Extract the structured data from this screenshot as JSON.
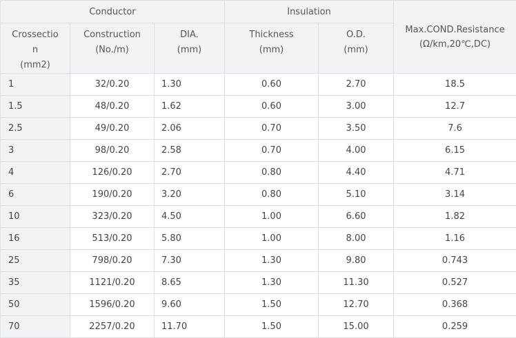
{
  "header": {
    "conductor": "Conductor",
    "insulation": "Insulation",
    "max_resistance": [
      "Max.COND.Resistance",
      "(Ω/km,20℃,DC)"
    ],
    "columns": [
      [
        "Crossectio",
        "n",
        "(mm2)"
      ],
      [
        "Construction",
        "(No./m)"
      ],
      [
        "DIA.",
        "(mm)"
      ],
      [
        "Thickness",
        "(mm)"
      ],
      [
        "O.D.",
        "(mm)"
      ]
    ]
  },
  "rows": [
    [
      "1",
      "32/0.20",
      "1.30",
      "0.60",
      "2.70",
      "18.5"
    ],
    [
      "1.5",
      "48/0.20",
      "1.62",
      "0.60",
      "3.00",
      "12.7"
    ],
    [
      "2.5",
      "49/0.20",
      "2.06",
      "0.70",
      "3.50",
      "7.6"
    ],
    [
      "3",
      "98/0.20",
      "2.58",
      "0.70",
      "4.00",
      "6.15"
    ],
    [
      "4",
      "126/0.20",
      "2.70",
      "0.80",
      "4.40",
      "4.71"
    ],
    [
      "6",
      "190/0.20",
      "3.20",
      "0.80",
      "5.10",
      "3.14"
    ],
    [
      "10",
      "323/0.20",
      "4.50",
      "1.00",
      "6.60",
      "1.82"
    ],
    [
      "16",
      "513/0.20",
      "5.80",
      "1.00",
      "8.00",
      "1.16"
    ],
    [
      "25",
      "798/0.20",
      "7.30",
      "1.30",
      "9.80",
      "0.743"
    ],
    [
      "35",
      "1121/0.20",
      "8.65",
      "1.30",
      "11.30",
      "0.527"
    ],
    [
      "50",
      "1596/0.20",
      "9.60",
      "1.50",
      "12.70",
      "0.368"
    ],
    [
      "70",
      "2257/0.20",
      "11.70",
      "1.50",
      "15.00",
      "0.259"
    ]
  ]
}
